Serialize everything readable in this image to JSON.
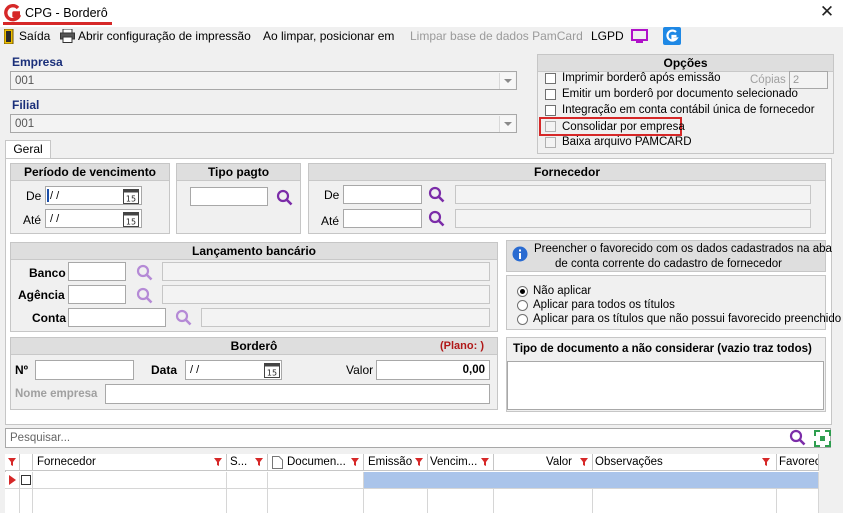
{
  "window": {
    "title": "CPG - Borderô"
  },
  "toolbar": {
    "saida": "Saída",
    "print_config": "Abrir configuração de impressão",
    "on_clear": "Ao limpar, posicionar em",
    "clear_pamcard": "Limpar base de dados PamCard",
    "lgpd": "LGPD"
  },
  "empresa": {
    "label": "Empresa",
    "value": "001"
  },
  "filial": {
    "label": "Filial",
    "value": "001"
  },
  "opcoes": {
    "title": "Opções",
    "items": [
      "Imprimir borderô após emissão",
      "Emitir um borderô por documento selecionado",
      "Integração em conta contábil única de fornecedor",
      "Consolidar por empresa",
      "Baixa arquivo PAMCARD"
    ],
    "copias_label": "Cópias",
    "copias_value": "2"
  },
  "tabs": {
    "geral": "Geral"
  },
  "periodo": {
    "title": "Período de vencimento",
    "de": "De",
    "ate": "Até",
    "de_value": "/ /",
    "ate_value": "/ /"
  },
  "tipo_pagto": {
    "title": "Tipo pagto"
  },
  "fornecedor": {
    "title": "Fornecedor",
    "de": "De",
    "ate": "Até"
  },
  "lancamento": {
    "title": "Lançamento bancário",
    "banco": "Banco",
    "agencia": "Agência",
    "conta": "Conta"
  },
  "favorecido": {
    "info_line1": "Preencher o favorecido com os dados cadastrados na aba",
    "info_line2": "de conta corrente do cadastro de fornecedor",
    "options": [
      "Não aplicar",
      "Aplicar para todos os títulos",
      "Aplicar para os títulos que não possui favorecido preenchido"
    ]
  },
  "bordero": {
    "title": "Borderô",
    "plano": "(Plano:  )",
    "numero_label": "Nº",
    "data_label": "Data",
    "data_value": "/ /",
    "valor_label": "Valor",
    "valor_value": "0,00",
    "nome_empresa_label": "Nome empresa"
  },
  "tipo_doc": {
    "title": "Tipo de documento a não considerar (vazio traz todos)"
  },
  "search": {
    "placeholder": "Pesquisar..."
  },
  "grid": {
    "columns": [
      "Fornecedor",
      "S...",
      "Documen...",
      "Emissão",
      "Vencim...",
      "Valor",
      "Observações",
      "Favorec"
    ]
  },
  "colors": {
    "accent_red": "#d62828",
    "icon_purple": "#7b2ca8",
    "highlight_row": "#aac4ea"
  }
}
